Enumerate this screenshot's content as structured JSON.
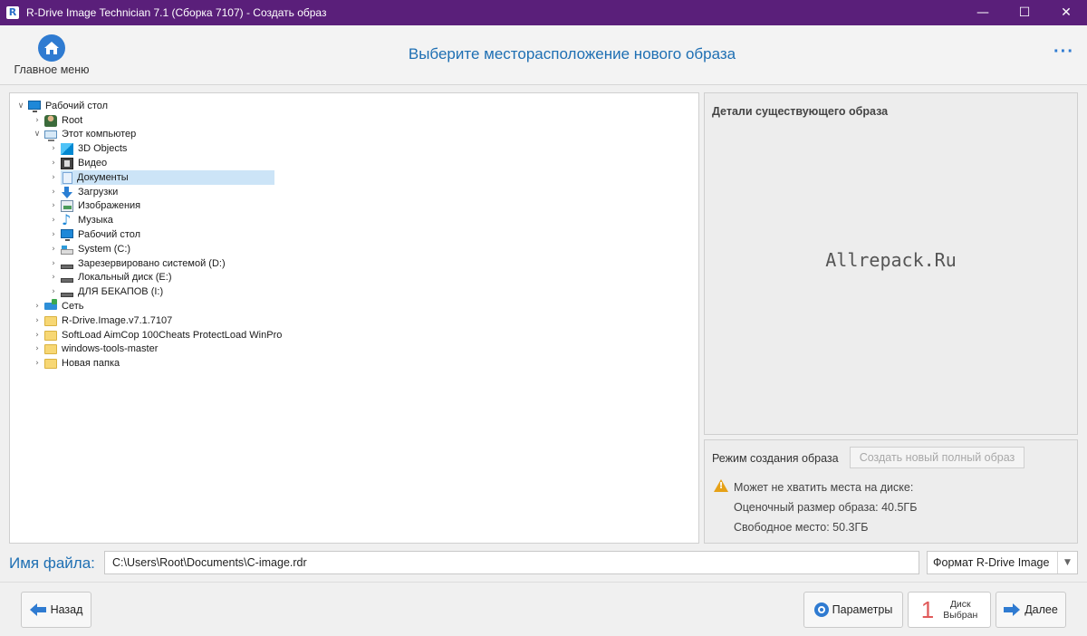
{
  "window": {
    "app_icon_letter": "R",
    "title": "R-Drive Image Technician 7.1 (Сборка 7107) - Создать образ",
    "minimize": "—",
    "maximize": "☐",
    "close": "✕"
  },
  "header": {
    "home_label": "Главное меню",
    "title": "Выберите месторасположение нового образа",
    "more": "···"
  },
  "tree": {
    "items": [
      {
        "label": "Рабочий стол",
        "icon": "desktop-icon",
        "chevron": "expanded"
      },
      {
        "label": "Root",
        "icon": "user-icon",
        "chevron": "collapsed"
      },
      {
        "label": "Этот компьютер",
        "icon": "computer-icon",
        "chevron": "expanded"
      },
      {
        "label": "3D Objects",
        "icon": "3d-objects-icon",
        "chevron": "collapsed"
      },
      {
        "label": "Видео",
        "icon": "video-icon",
        "chevron": "collapsed"
      },
      {
        "label": "Документы",
        "icon": "documents-icon",
        "chevron": "collapsed",
        "selected": true
      },
      {
        "label": "Загрузки",
        "icon": "downloads-icon",
        "chevron": "collapsed"
      },
      {
        "label": "Изображения",
        "icon": "images-icon",
        "chevron": "collapsed"
      },
      {
        "label": "Музыка",
        "icon": "music-icon",
        "chevron": "collapsed"
      },
      {
        "label": "Рабочий стол",
        "icon": "desktop-icon",
        "chevron": "collapsed"
      },
      {
        "label": "System (C:)",
        "icon": "system-drive-icon",
        "chevron": "collapsed"
      },
      {
        "label": "Зарезервировано системой (D:)",
        "icon": "drive-icon",
        "chevron": "collapsed"
      },
      {
        "label": "Локальный диск (E:)",
        "icon": "drive-icon",
        "chevron": "collapsed"
      },
      {
        "label": "ДЛЯ БЕКАПОВ (I:)",
        "icon": "drive-icon",
        "chevron": "collapsed"
      },
      {
        "label": "Сеть",
        "icon": "network-icon",
        "chevron": "collapsed"
      },
      {
        "label": "R-Drive.Image.v7.1.7107",
        "icon": "folder-icon",
        "chevron": "collapsed"
      },
      {
        "label": "SoftLoad AimCop 100Cheats ProtectLoad WinPro",
        "icon": "folder-icon",
        "chevron": "collapsed"
      },
      {
        "label": "windows-tools-master",
        "icon": "folder-icon",
        "chevron": "collapsed"
      },
      {
        "label": "Новая папка",
        "icon": "folder-icon",
        "chevron": "collapsed"
      }
    ]
  },
  "details": {
    "title": "Детали существующего образа",
    "watermark": "Allrepack.Ru"
  },
  "mode": {
    "label": "Режим создания образа",
    "button": "Создать новый полный образ",
    "warning": "Может не хватить места на диске:",
    "estimated": "Оценочный размер образа: 40.5ГБ",
    "free": "Свободное место: 50.3ГБ"
  },
  "filename": {
    "label": "Имя файла:",
    "value": "C:\\Users\\Root\\Documents\\C-image.rdr",
    "format": "Формат R-Drive Image"
  },
  "footer": {
    "back": "Назад",
    "params": "Параметры",
    "disk_count": "1",
    "disk_line1": "Диск",
    "disk_line2": "Выбран",
    "next": "Далее"
  },
  "colors": {
    "titlebar": "#5a1f7a",
    "accent": "#1e6fb3",
    "selection": "#cce4f7",
    "warning": "#e6a117"
  }
}
